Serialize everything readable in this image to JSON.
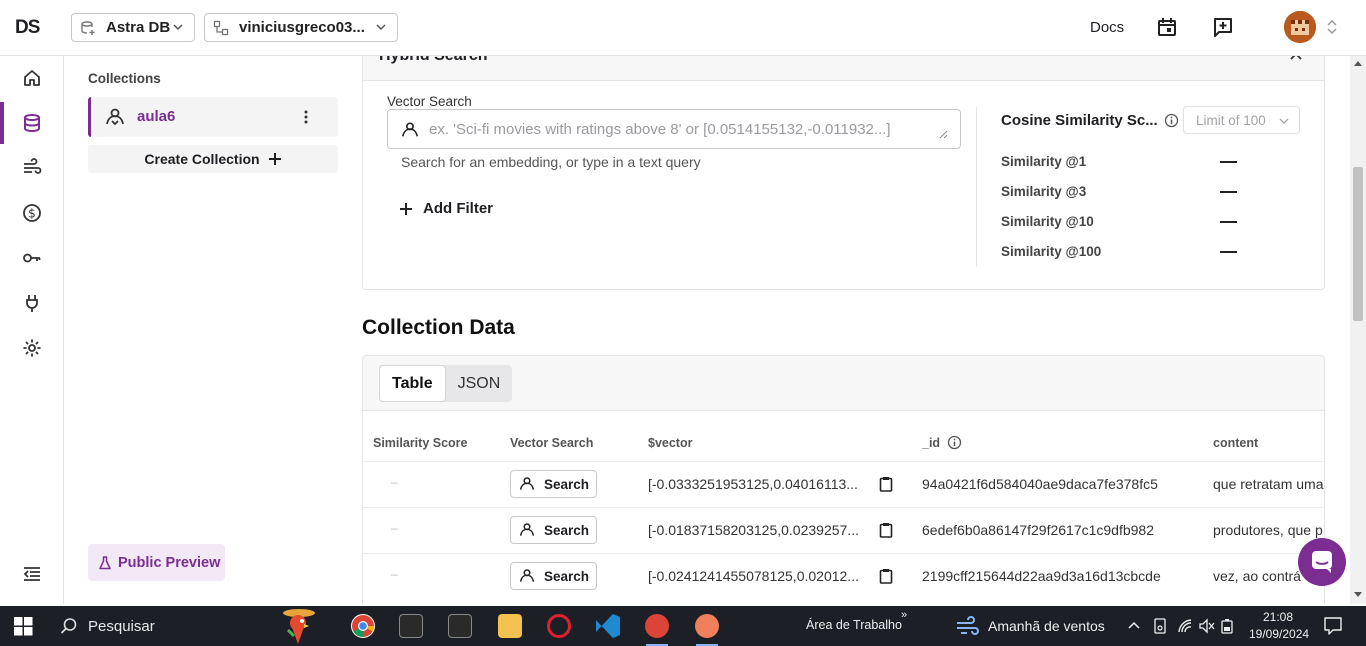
{
  "topbar": {
    "logo": "DS",
    "product_select": "Astra DB",
    "org_select": "viniciusgreco03...",
    "docs_label": "Docs"
  },
  "leftnav": {
    "items": [
      "home-icon",
      "database-icon",
      "streaming-icon",
      "billing-icon",
      "key-icon",
      "plug-icon",
      "settings-icon",
      "collapse-nav-icon"
    ]
  },
  "collections": {
    "title": "Collections",
    "items": [
      {
        "name": "aula6"
      }
    ],
    "create_label": "Create Collection",
    "preview_label": "Public Preview"
  },
  "hybrid_search": {
    "title": "Hybrid Search",
    "vector_search_label": "Vector Search",
    "placeholder": "ex. 'Sci-fi movies with ratings above 8' or [0.0514155132,-0.011932...]",
    "help_text": "Search for an embedding, or type in a text query",
    "add_filter_label": "Add Filter",
    "cosine_title": "Cosine Similarity Sc...",
    "limit_label": "Limit of 100",
    "similarities": [
      {
        "label": "Similarity @1",
        "value": "—"
      },
      {
        "label": "Similarity @3",
        "value": "—"
      },
      {
        "label": "Similarity @10",
        "value": "—"
      },
      {
        "label": "Similarity @100",
        "value": "—"
      }
    ]
  },
  "collection_data": {
    "title": "Collection Data",
    "tabs": [
      {
        "label": "Table",
        "active": true
      },
      {
        "label": "JSON",
        "active": false
      }
    ],
    "columns": [
      "Similarity Score",
      "Vector Search",
      "$vector",
      "_id",
      "content"
    ],
    "search_label": "Search",
    "rows": [
      {
        "similarity": "–",
        "vector": "[-0.0333251953125,0.04016113...",
        "id": "94a0421f6d584040ae9daca7fe378fc5",
        "content": "que retratam uma"
      },
      {
        "similarity": "–",
        "vector": "[-0.01837158203125,0.0239257...",
        "id": "6edef6b0a86147f29f2617c1c9dfb982",
        "content": "produtores, que p"
      },
      {
        "similarity": "–",
        "vector": "[-0.0241241455078125,0.02012...",
        "id": "2199cff215644d22aa9d3a16d13cbcde",
        "content": "vez, ao contrá"
      }
    ]
  },
  "taskbar": {
    "search_placeholder": "Pesquisar",
    "desktop_label": "Área de Trabalho",
    "weather": "Amanhã de ventos",
    "time": "21:08",
    "date": "19/09/2024"
  },
  "colors": {
    "accent": "#7b2d92",
    "taskbar": "#1c2026"
  }
}
